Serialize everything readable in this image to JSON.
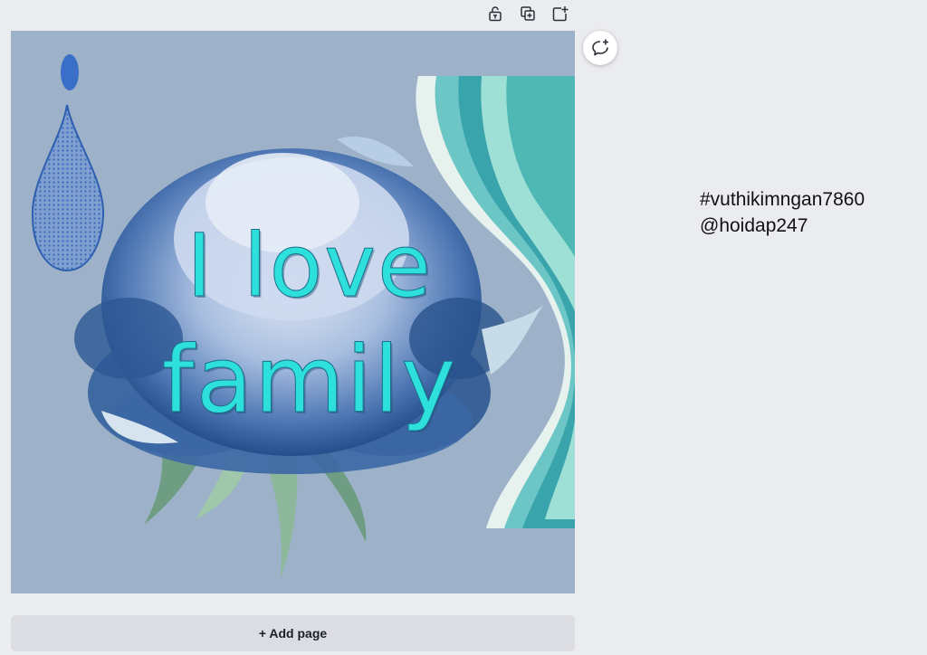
{
  "toolbar": {
    "icons": [
      "lock-icon",
      "duplicate-page-icon",
      "add-page-icon"
    ]
  },
  "canvas": {
    "background": "#9db2c9",
    "headline": {
      "line1": "I love",
      "line2": "family",
      "color": "#2ee0dc"
    }
  },
  "comment": {
    "icon": "add-comment-icon"
  },
  "side_notes": {
    "line1": "#vuthikimngan7860",
    "line2": "@hoidap247"
  },
  "add_page": {
    "label": "+ Add page"
  }
}
